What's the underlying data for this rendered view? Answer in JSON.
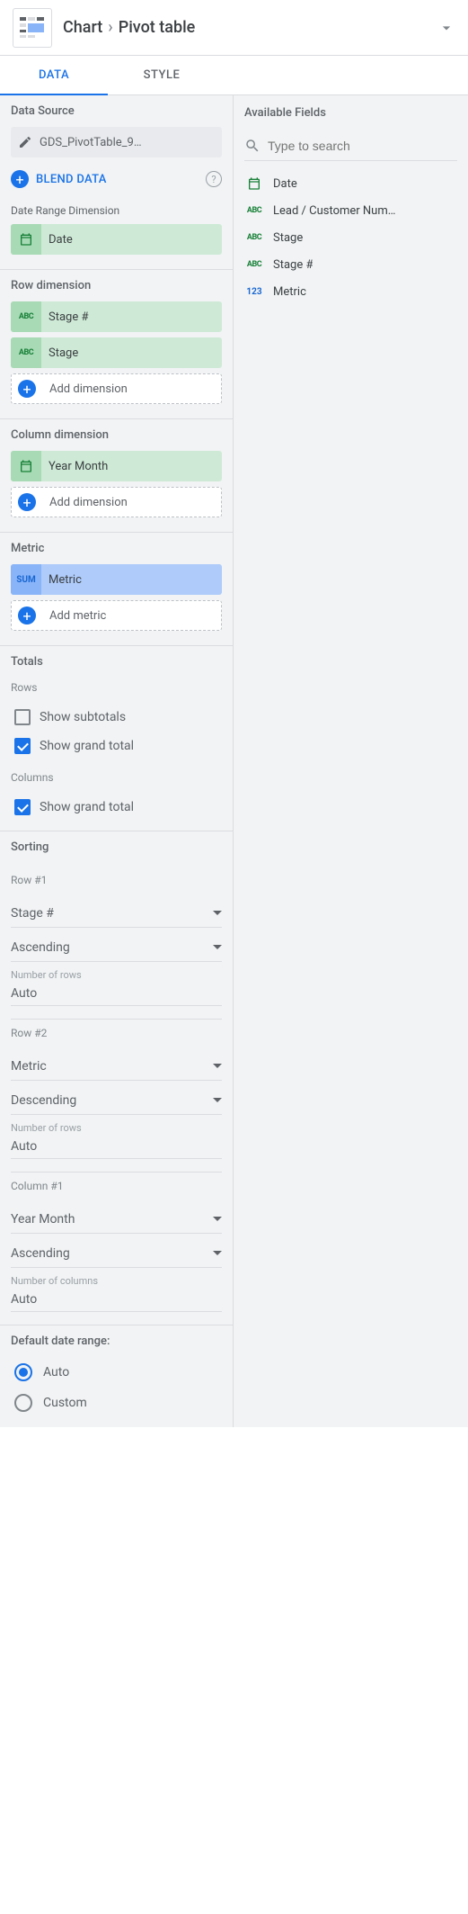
{
  "header": {
    "breadcrumb1": "Chart",
    "breadcrumb2": "Pivot table"
  },
  "tabs": {
    "data": "DATA",
    "style": "STYLE"
  },
  "data_source": {
    "title": "Data Source",
    "name": "GDS_PivotTable_9…",
    "blend": "BLEND DATA"
  },
  "date_range": {
    "title": "Date Range Dimension",
    "chip": "Date"
  },
  "row_dim": {
    "title": "Row dimension",
    "chips": [
      "Stage #",
      "Stage"
    ],
    "add": "Add dimension"
  },
  "col_dim": {
    "title": "Column dimension",
    "chip": "Year Month",
    "add": "Add dimension"
  },
  "metric": {
    "title": "Metric",
    "chip": "Metric",
    "sum": "SUM",
    "add": "Add metric"
  },
  "totals": {
    "title": "Totals",
    "rows_label": "Rows",
    "cols_label": "Columns",
    "show_subtotals": "Show subtotals",
    "show_grand_rows": "Show grand total",
    "show_grand_cols": "Show grand total"
  },
  "sorting": {
    "title": "Sorting",
    "rows": [
      {
        "label": "Row #1",
        "field": "Stage #",
        "dir": "Ascending",
        "num_label": "Number of rows",
        "num_val": "Auto"
      },
      {
        "label": "Row #2",
        "field": "Metric",
        "dir": "Descending",
        "num_label": "Number of rows",
        "num_val": "Auto"
      }
    ],
    "cols": [
      {
        "label": "Column #1",
        "field": "Year Month",
        "dir": "Ascending",
        "num_label": "Number of columns",
        "num_val": "Auto"
      }
    ]
  },
  "date_default": {
    "title": "Default date range:",
    "auto": "Auto",
    "custom": "Custom"
  },
  "fields": {
    "title": "Available Fields",
    "placeholder": "Type to search",
    "items": [
      {
        "type": "date",
        "name": "Date"
      },
      {
        "type": "abc",
        "name": "Lead / Customer Num…"
      },
      {
        "type": "abc",
        "name": "Stage"
      },
      {
        "type": "abc",
        "name": "Stage #"
      },
      {
        "type": "123",
        "name": "Metric"
      }
    ]
  }
}
